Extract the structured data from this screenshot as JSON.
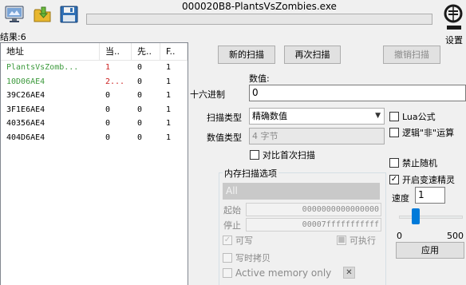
{
  "window": {
    "title": "000020B8-PlantsVsZombies.exe"
  },
  "toolbar": {
    "open_process_icon": "monitor-icon",
    "open_file_icon": "folder-icon",
    "save_icon": "floppy-disk-icon",
    "progress": 0
  },
  "settings": {
    "label": "设置",
    "icon": "cheat-engine-logo-icon"
  },
  "results": {
    "label": "结果:6"
  },
  "address_list": {
    "columns": [
      "地址",
      "当..",
      "先..",
      "F.."
    ],
    "rows": [
      {
        "address": "PlantsVsZomb...",
        "current": "1",
        "previous": "0",
        "first": "1",
        "color": "#3d9a3d"
      },
      {
        "address": "10D06AE4",
        "current": "2...",
        "previous": "0",
        "first": "1",
        "color": "#3d9a3d"
      },
      {
        "address": "39C26AE4",
        "current": "0",
        "previous": "0",
        "first": "1",
        "color": "#000000"
      },
      {
        "address": "3F1E6AE4",
        "current": "0",
        "previous": "0",
        "first": "1",
        "color": "#000000"
      },
      {
        "address": "40356AE4",
        "current": "0",
        "previous": "0",
        "first": "1",
        "color": "#000000"
      },
      {
        "address": "404D6AE4",
        "current": "0",
        "previous": "0",
        "first": "1",
        "color": "#000000"
      }
    ]
  },
  "buttons": {
    "new_scan": "新的扫描",
    "next_scan": "再次扫描",
    "undo_scan": "撤销扫描"
  },
  "value": {
    "label": "数值:",
    "hex_label": "十六进制",
    "value": "0"
  },
  "scan_type": {
    "label": "扫描类型",
    "selected": "精确数值"
  },
  "value_type": {
    "label": "数值类型",
    "selected": "4 字节"
  },
  "compare_first": {
    "label": "对比首次扫描",
    "checked": false
  },
  "lua_formula": {
    "label": "Lua公式",
    "checked": false
  },
  "logic_not": {
    "label": "逻辑\"非\"运算",
    "checked": false
  },
  "disable_random": {
    "label": "禁止随机",
    "checked": false
  },
  "speedhack": {
    "label": "开启变速精灵",
    "checked": true
  },
  "speed": {
    "label": "速度",
    "value": "1",
    "min": "0",
    "max": "500",
    "slider_level": 0.2,
    "apply": "应用"
  },
  "memory_options": {
    "title": "内存扫描选项",
    "region": "All",
    "start_label": "起始",
    "start_value": "0000000000000000",
    "stop_label": "停止",
    "stop_value": "00007fffffffffff",
    "writable": "可写",
    "executable": "可执行",
    "copy_on_write": "写时拷贝",
    "active_memory": "Active memory only",
    "close_glyph": "✕"
  }
}
